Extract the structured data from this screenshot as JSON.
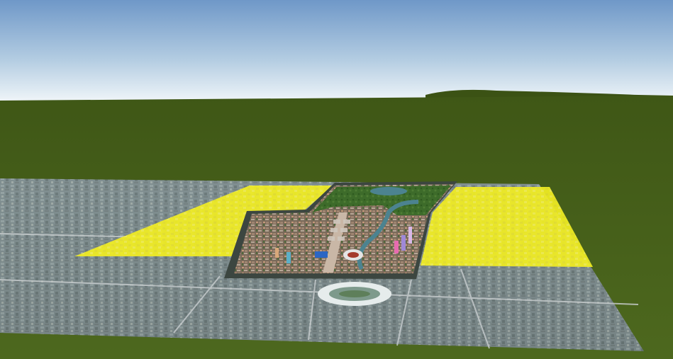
{
  "scene": {
    "type": "3d-globe-viewport",
    "colors": {
      "sky_top": "#6f98c8",
      "sky_horizon": "#eef4f8",
      "terrain": "#4a651c",
      "terrain_far": "#3f5716",
      "imagery_base": "#7c8b8d",
      "highlight_overlay": "#f2ee22",
      "model_border": "#3c4640",
      "park_green": "#3d6b2a",
      "water": "#4c8390",
      "stadium": "#e6ecec"
    },
    "layers": [
      {
        "name": "sky",
        "description_icon": "sky-gradient"
      },
      {
        "name": "terrain",
        "description_icon": "ground-plane"
      },
      {
        "name": "satellite-imagery",
        "description_icon": "imagery-tile"
      },
      {
        "name": "selection-highlight-left",
        "description_icon": "polygon-highlight"
      },
      {
        "name": "selection-highlight-right",
        "description_icon": "polygon-highlight"
      },
      {
        "name": "city-3d-model",
        "description_icon": "model-tile"
      }
    ]
  }
}
